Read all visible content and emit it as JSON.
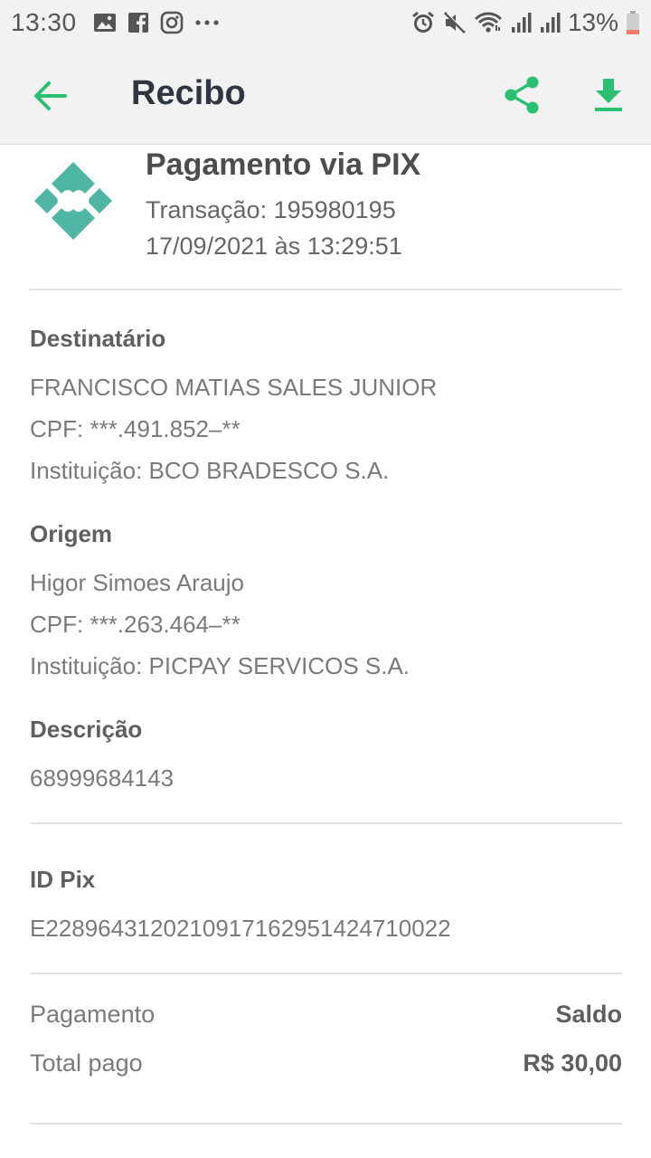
{
  "status_bar": {
    "time": "13:30",
    "battery": "13%",
    "icons": [
      "image-icon",
      "facebook-icon",
      "instagram-icon",
      "more-icon",
      "alarm-icon",
      "mute-icon",
      "wifi-icon",
      "signal-icon",
      "signal-icon",
      "battery-icon"
    ]
  },
  "app_bar": {
    "title": "Recibo",
    "accent_color": "#2bbf72"
  },
  "header": {
    "title": "Pagamento via PIX",
    "transaction": "Transação: 195980195",
    "datetime": "17/09/2021 às 13:29:51",
    "logo_color": "#4fb5a5"
  },
  "recipient": {
    "label": "Destinatário",
    "name": "FRANCISCO MATIAS SALES JUNIOR",
    "cpf": "CPF: ***.491.852–**",
    "institution": "Instituição: BCO BRADESCO S.A."
  },
  "origin": {
    "label": "Origem",
    "name": "Higor Simoes Araujo",
    "cpf": "CPF: ***.263.464–**",
    "institution": "Instituição: PICPAY SERVICOS S.A."
  },
  "description": {
    "label": "Descrição",
    "value": "68999684143"
  },
  "pix_id": {
    "label": "ID Pix",
    "value": "E22896431202109171629514247100​22"
  },
  "payment": {
    "method_label": "Pagamento",
    "method_value": "Saldo",
    "total_label": "Total pago",
    "total_value": "R$ 30,00"
  }
}
